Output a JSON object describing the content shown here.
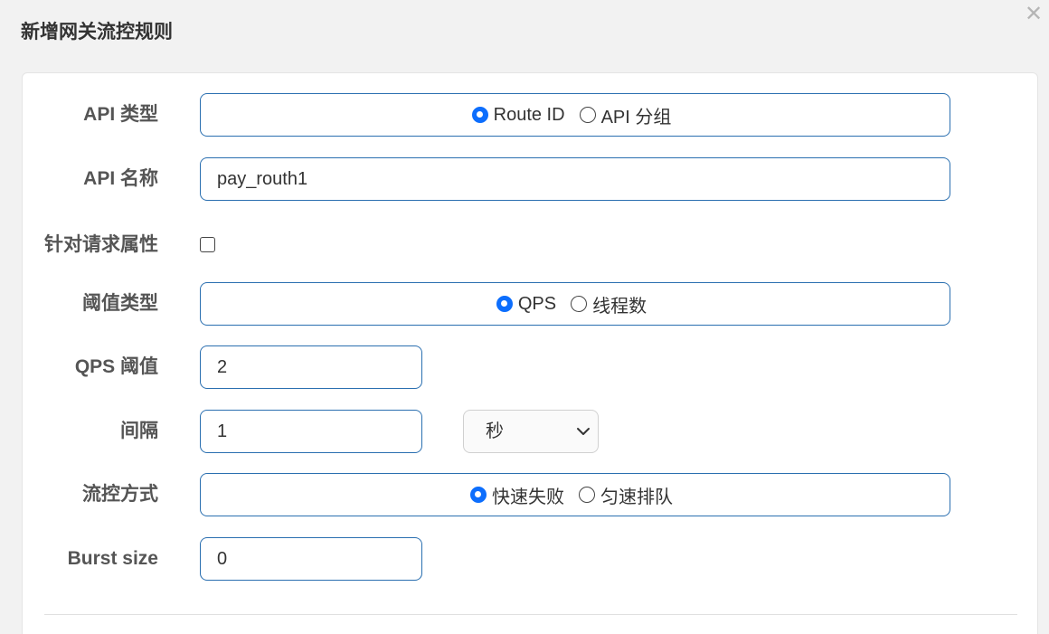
{
  "dialog": {
    "title": "新增网关流控规则"
  },
  "form": {
    "api_type": {
      "label": "API 类型",
      "options": [
        "Route ID",
        "API 分组"
      ],
      "selected": "Route ID"
    },
    "api_name": {
      "label": "API 名称",
      "value": "pay_routh1"
    },
    "request_attr": {
      "label": "针对请求属性",
      "checked": false
    },
    "threshold_type": {
      "label": "阈值类型",
      "options": [
        "QPS",
        "线程数"
      ],
      "selected": "QPS"
    },
    "qps_threshold": {
      "label": "QPS 阈值",
      "value": "2"
    },
    "interval": {
      "label": "间隔",
      "value": "1",
      "unit": "秒"
    },
    "control_behavior": {
      "label": "流控方式",
      "options": [
        "快速失败",
        "匀速排队"
      ],
      "selected": "快速失败"
    },
    "burst_size": {
      "label": "Burst size",
      "value": "0"
    }
  },
  "colors": {
    "accent": "#0d6efd",
    "input_border": "#2a6fb0",
    "background": "#f2f2f2"
  }
}
